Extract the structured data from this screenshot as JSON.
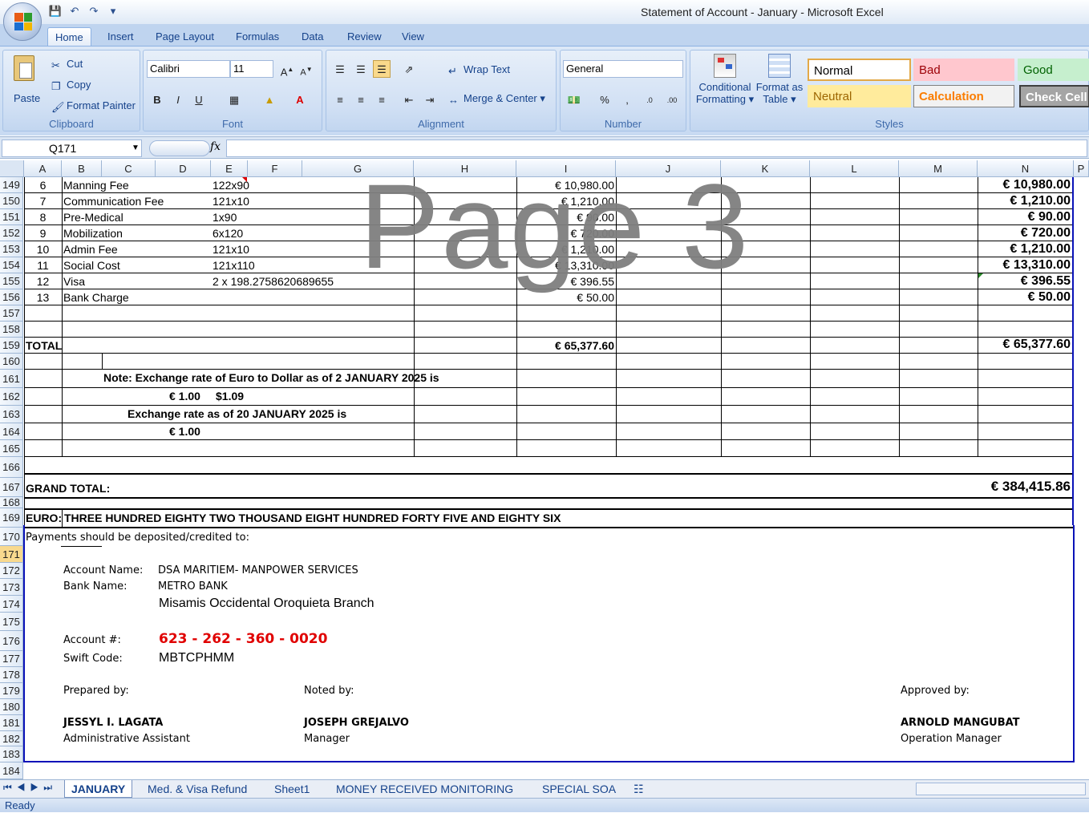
{
  "window": {
    "title": "Statement of Account - January - Microsoft Excel"
  },
  "ribbon_tabs": [
    "Home",
    "Insert",
    "Page Layout",
    "Formulas",
    "Data",
    "Review",
    "View"
  ],
  "clipboard": {
    "paste": "Paste",
    "cut": "Cut",
    "copy": "Copy",
    "format_painter": "Format Painter",
    "label": "Clipboard"
  },
  "font": {
    "name": "Calibri",
    "size": "11",
    "label": "Font"
  },
  "alignment": {
    "wrap": "Wrap Text",
    "merge": "Merge & Center",
    "label": "Alignment"
  },
  "number": {
    "format": "General",
    "label": "Number"
  },
  "styles": {
    "conditional": "Conditional",
    "formatting": "Formatting",
    "format_as": "Format as",
    "table": "Table",
    "normal": "Normal",
    "bad": "Bad",
    "good": "Good",
    "neutral": "Neutral",
    "calculation": "Calculation",
    "check_cell": "Check Cell",
    "label": "Styles"
  },
  "name_box": "Q171",
  "fx": "fx",
  "columns": [
    "A",
    "B",
    "C",
    "D",
    "E",
    "F",
    "G",
    "H",
    "I",
    "J",
    "K",
    "L",
    "M",
    "N",
    "P"
  ],
  "rows": [
    "149",
    "150",
    "151",
    "152",
    "153",
    "154",
    "155",
    "156",
    "157",
    "158",
    "159",
    "160",
    "161",
    "162",
    "163",
    "164",
    "165",
    "166",
    "167",
    "168",
    "169",
    "170",
    "171",
    "172",
    "173",
    "174",
    "175",
    "176",
    "177",
    "178",
    "179",
    "180",
    "181",
    "182",
    "183",
    "184"
  ],
  "items": [
    {
      "no": "6",
      "desc": "Manning Fee",
      "qty": "122x90",
      "amount": "€ 10,980.00",
      "total": "€ 10,980.00"
    },
    {
      "no": "7",
      "desc": "Communication Fee",
      "qty": "121x10",
      "amount": "€ 1,210.00",
      "total": "€ 1,210.00"
    },
    {
      "no": "8",
      "desc": "Pre-Medical",
      "qty": "1x90",
      "amount": "€ 90.00",
      "total": "€ 90.00"
    },
    {
      "no": "9",
      "desc": "Mobilization",
      "qty": "6x120",
      "amount": "€ 720.00",
      "total": "€ 720.00"
    },
    {
      "no": "10",
      "desc": "Admin Fee",
      "qty": "121x10",
      "amount": "€ 1,210.00",
      "total": "€ 1,210.00"
    },
    {
      "no": "11",
      "desc": "Social Cost",
      "qty": "121x110",
      "amount": "€ 13,310.00",
      "total": "€ 13,310.00"
    },
    {
      "no": "12",
      "desc": "Visa",
      "qty": "2 x 198.2758620689655",
      "amount": "€ 396.55",
      "total": "€ 396.55"
    },
    {
      "no": "13",
      "desc": "Bank Charge",
      "qty": "",
      "amount": "€ 50.00",
      "total": "€ 50.00"
    }
  ],
  "total": {
    "label": "TOTAL",
    "amount": "€ 65,377.60",
    "total": "€ 65,377.60"
  },
  "note1": "Note: Exchange rate of Euro to Dollar as of 2 JANUARY 2025 is",
  "rate1_eur": "€ 1.00",
  "rate1_usd": "$1.09",
  "note2": "Exchange rate as of 20 JANUARY 2025  is",
  "rate2_eur": "€ 1.00",
  "grand_total": {
    "label": "GRAND TOTAL:",
    "amount": "€ 384,415.86"
  },
  "euro_words": {
    "label": "EURO:",
    "text": "THREE HUNDRED EIGHTY TWO THOUSAND EIGHT HUNDRED FORTY FIVE AND EIGHTY SIX"
  },
  "payment": {
    "intro": "Payments should be deposited/credited to:",
    "account_name_label": "Account Name:",
    "account_name": "DSA MARITIEM- MANPOWER SERVICES",
    "bank_name_label": "Bank Name:",
    "bank_name": "METRO BANK",
    "branch": "Misamis Occidental Oroquieta Branch",
    "account_no_label": "Account #:",
    "account_no": "623 - 262 - 360 - 0020",
    "swift_label": "Swift Code:",
    "swift": "MBTCPHMM"
  },
  "signatories": {
    "prepared_label": "Prepared by:",
    "prepared_name": "JESSYL I. LAGATA",
    "prepared_title": "Administrative Assistant",
    "noted_label": "Noted by:",
    "noted_name": "JOSEPH GREJALVO",
    "noted_title": "Manager",
    "approved_label": "Approved by:",
    "approved_name": "ARNOLD MANGUBAT",
    "approved_title": "Operation Manager"
  },
  "watermark": "Page 3",
  "sheet_tabs": [
    "JANUARY",
    "Med. & Visa Refund",
    "Sheet1",
    "MONEY RECEIVED MONITORING",
    "SPECIAL SOA"
  ],
  "status": "Ready",
  "colors": {
    "account_no": "#e00000",
    "accent": "#15428b",
    "selected_row": "#f8d98e"
  }
}
